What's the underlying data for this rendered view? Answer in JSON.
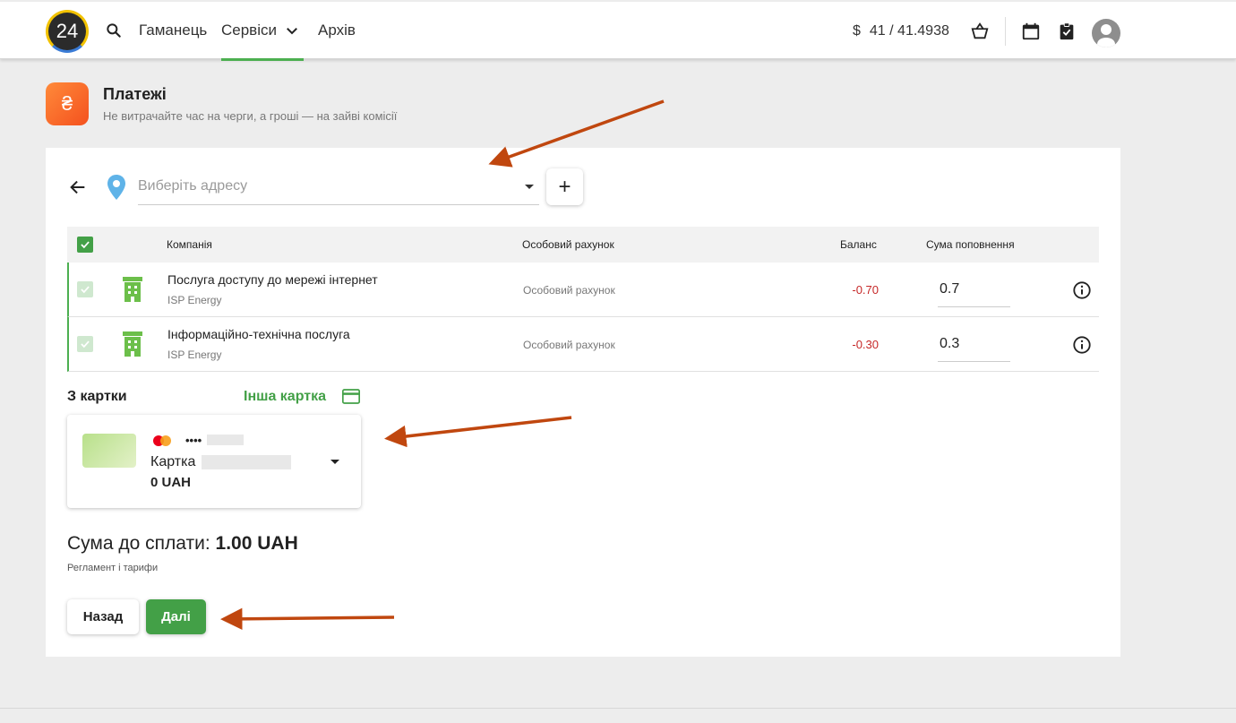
{
  "header": {
    "logo_text": "24",
    "nav": [
      "Гаманець",
      "Сервіси",
      "Архів"
    ],
    "currency_symbol": "$",
    "rate": "41 / 41.4938",
    "accent_color": "#4caf50"
  },
  "page": {
    "title": "Платежі",
    "subtitle": "Не витрачайте час на черги, а гроші — на зайві комісії",
    "icon_glyph": "₴"
  },
  "address": {
    "placeholder": "Виберіть адресу",
    "add_label": "+"
  },
  "table": {
    "headers": [
      "Компанія",
      "Особовий рахунок",
      "Баланс",
      "Сума поповнення"
    ],
    "rows": [
      {
        "company": "Послуга доступу до мережі інтернет",
        "provider": "ISP Energy",
        "account": "Особовий рахунок",
        "balance": "-0.70",
        "amount": "0.7"
      },
      {
        "company": "Інформаційно-технічна послуга",
        "provider": "ISP Energy",
        "account": "Особовий рахунок",
        "balance": "-0.30",
        "amount": "0.3"
      }
    ]
  },
  "payment": {
    "from_card_label": "З картки",
    "other_card_label": "Інша картка",
    "card_mask": "••••",
    "card_name": "Картка",
    "card_balance": "0 UAH"
  },
  "total": {
    "label": "Сума до сплати:",
    "amount": "1.00 UAH",
    "tariffs_link": "Регламент і тарифи"
  },
  "buttons": {
    "back": "Назад",
    "next": "Далі"
  }
}
